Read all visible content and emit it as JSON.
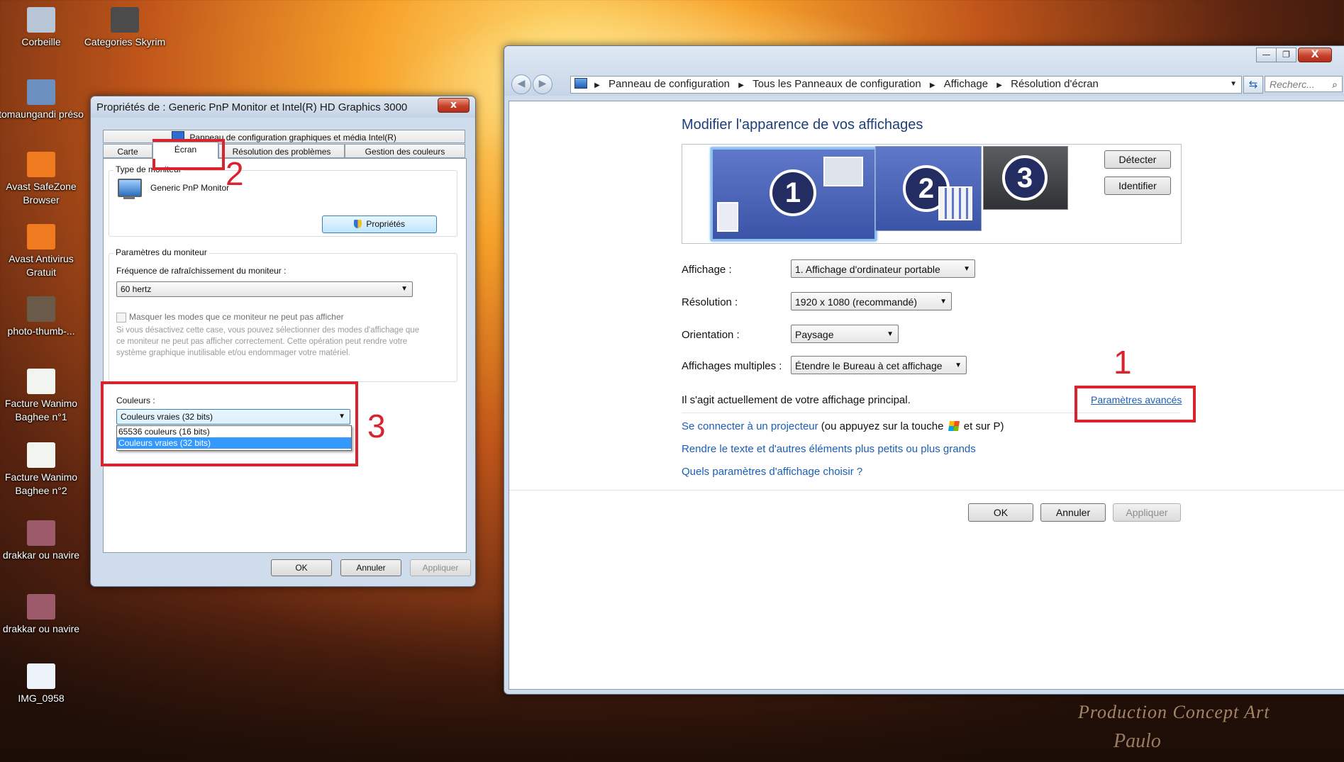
{
  "desktop": {
    "icons": [
      {
        "label": "Corbeille",
        "color": "#b7c5d6"
      },
      {
        "label": "Categories Skyrim",
        "color": "#4b4b4b"
      },
      {
        "label": "tomaungandi préso",
        "color": "#6b8fbf"
      },
      {
        "label": "Avast SafeZone Browser",
        "color": "#f07a20"
      },
      {
        "label": "Avast Antivirus Gratuit",
        "color": "#f07a20"
      },
      {
        "label": "photo-thumb-...",
        "color": "#6a5a4a"
      },
      {
        "label": "Facture Wanimo Baghee n°1",
        "color": "#f2f4f0"
      },
      {
        "label": "Facture Wanimo Baghee n°2",
        "color": "#f2f4f0"
      },
      {
        "label": "drakkar ou navire",
        "color": "#9c5a6a"
      },
      {
        "label": "drakkar ou navire",
        "color": "#9c5a6a"
      },
      {
        "label": "IMG_0958",
        "color": "#eef2fa"
      }
    ],
    "watermark": "Production Concept Art",
    "signature": "Paulo"
  },
  "props_dialog": {
    "title": "Propriétés de : Generic PnP Monitor et Intel(R) HD Graphics 3000",
    "close": "x",
    "tab_intel": "Panneau de configuration graphiques et média Intel(R)",
    "tabs": [
      "Carte",
      "Écran",
      "Résolution des problèmes",
      "Gestion des couleurs"
    ],
    "monitor_type_label": "Type de moniteur",
    "monitor_name": "Generic PnP Monitor",
    "properties_button": "Propriétés",
    "monitor_settings_label": "Paramètres du moniteur",
    "refresh_label": "Fréquence de rafraîchissement du moniteur :",
    "refresh_value": "60 hertz",
    "hide_modes_label": "Masquer les modes que ce moniteur ne peut pas afficher",
    "hide_modes_desc": "Si vous désactivez cette case, vous pouvez sélectionner des modes d'affichage que ce moniteur ne peut pas afficher correctement. Cette opération peut rendre votre système graphique inutilisable et/ou endommager votre matériel.",
    "colors_label": "Couleurs :",
    "colors_value": "Couleurs vraies (32 bits)",
    "colors_options": [
      "65536 couleurs (16 bits)",
      "Couleurs vraies (32 bits)"
    ],
    "ok": "OK",
    "cancel": "Annuler",
    "apply": "Appliquer",
    "annot_tab": "2",
    "annot_colors": "3"
  },
  "display_window": {
    "controls": {
      "minimize": "—",
      "maximize": "❐",
      "close": "X"
    },
    "breadcrumb": [
      "Panneau de configuration",
      "Tous les Panneaux de configuration",
      "Affichage",
      "Résolution d'écran"
    ],
    "search_placeholder": "Recherc...",
    "heading": "Modifier l'apparence de vos affichages",
    "monitors": [
      "1",
      "2",
      "3"
    ],
    "detect_button": "Détecter",
    "identify_button": "Identifier",
    "affichage_label": "Affichage :",
    "affichage_value": "1. Affichage d'ordinateur portable",
    "resolution_label": "Résolution :",
    "resolution_value": "1920 x 1080 (recommandé)",
    "orientation_label": "Orientation :",
    "orientation_value": "Paysage",
    "multiple_label": "Affichages multiples :",
    "multiple_value": "Étendre le Bureau à cet affichage",
    "main_display_text": "Il s'agit actuellement de votre affichage principal.",
    "advanced_link": "Paramètres avancés",
    "projector_link": "Se connecter à un projecteur",
    "projector_hint_a": "(ou appuyez sur la touche",
    "projector_hint_b": "et sur P)",
    "text_size_link": "Rendre le texte et d'autres éléments plus petits ou plus grands",
    "which_settings_link": "Quels paramètres d'affichage choisir ?",
    "ok": "OK",
    "cancel": "Annuler",
    "apply": "Appliquer",
    "annot_advanced": "1"
  },
  "colors": {
    "annotation_red": "#d9232d",
    "link_blue": "#1a5fb4",
    "heading_blue": "#1e3f7a",
    "selection_blue": "#3399ff",
    "monitor_blue": "#4b63b5"
  }
}
